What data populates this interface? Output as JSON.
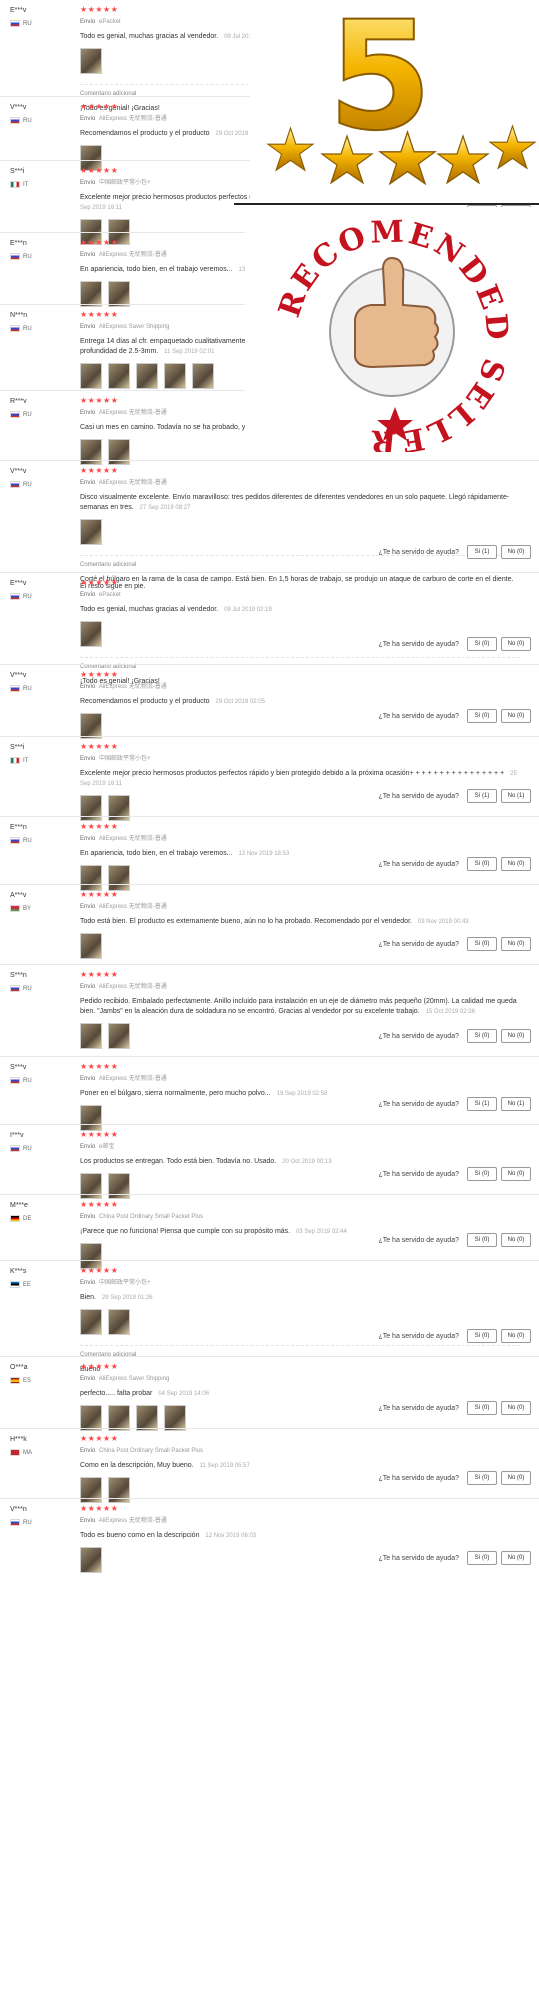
{
  "helpful_question": "¿Te ha servido de ayuda?",
  "shipping_label": "Envío",
  "additional_title": "Comentario adicional",
  "badge": {
    "number": "5",
    "stamp_text": "RECOMENDED SELLER"
  },
  "colors": {
    "star": "#ff4747",
    "gold": "#f4b400",
    "stamp_red": "#c4121e"
  },
  "reviews": [
    {
      "user": "E***v",
      "country": "RU",
      "stars": "★★★★★",
      "shipping": "ePacket",
      "text": "Todo es genial, muchas gracias al vendedor.",
      "date": "09 Jul 2019 02:19",
      "photos": 1,
      "additional": "¡Todo es genial! ¡Gracias!",
      "yes": "Sí (0)",
      "no": "No (0)"
    },
    {
      "user": "V***v",
      "country": "RU",
      "stars": "★★★★★",
      "shipping": "AliExpress 无忧物流-普通",
      "text": "Recomendamos el producto y el producto",
      "date": "29 Oct 2019 02:05",
      "photos": 1,
      "additional": "",
      "yes": "Sí (0)",
      "no": "No (0)"
    },
    {
      "user": "S***i",
      "country": "IT",
      "stars": "★★★★★",
      "shipping": "中国邮政平常小包+",
      "text": "Excelente mejor precio hermosos productos perfectos rápido y bien protegido debido a la próxima ocasión+ + + + + + + + + + + + + + + +",
      "date": "25 Sep 2019 16:11",
      "photos": 2,
      "additional": "",
      "yes": "Sí (1)",
      "no": "No (1)"
    },
    {
      "user": "E***n",
      "country": "RU",
      "stars": "★★★★★",
      "shipping": "AliExpress 无忧物流-普通",
      "text": "En apariencia, todo bien, en el trabajo veremos...",
      "date": "13 Nov 2019 18:53",
      "photos": 2,
      "additional": "",
      "yes": "Sí (0)",
      "no": "No (0)"
    },
    {
      "user": "N***n",
      "country": "RU",
      "stars": "★★★★★",
      "shipping": "AliExpress Saver Shipping",
      "text": "Entrega 14 días al cfr. empaquetado cualitativamente. El producto corresponde a la descripción. La adaptadora para 20mm., en la profundidad de 2.5-3mm.",
      "date": "11 Sep 2019 02:01",
      "photos": 5,
      "additional": "",
      "yes": "Sí (4)",
      "no": "No (3)"
    },
    {
      "user": "R***v",
      "country": "RU",
      "stars": "★★★★★",
      "shipping": "AliExpress 无忧物流-普通",
      "text": "Casi un mes en camino. Todavía no se ha probado, ya que estoy en el reloj",
      "date": "06 Nov 2019 23:08",
      "photos": 2,
      "additional": "",
      "yes": "Sí (0)",
      "no": "No (0)"
    },
    {
      "user": "V***v",
      "country": "RU",
      "stars": "★★★★★",
      "shipping": "AliExpress 无忧物流-普通",
      "text": "Disco visualmente excelente. Envío maravilloso: tres pedidos diferentes de diferentes vendedores en un solo paquete. Llegó rápidamente-semanas en tres.",
      "date": "27 Sep 2019 08:27",
      "photos": 1,
      "additional": "Corté el búlgaro en la rama de la casa de campo. Está bien. En 1,5 horas de trabajo, se produjo un ataque de carburo de corte en el diente. El resto sigue en pie.",
      "yes": "Sí (1)",
      "no": "No (0)"
    },
    {
      "user": "E***v",
      "country": "RU",
      "stars": "★★★★★",
      "shipping": "ePacket",
      "text": "Todo es genial, muchas gracias al vendedor.",
      "date": "09 Jul 2019 02:19",
      "photos": 1,
      "additional": "¡Todo es genial! ¡Gracias!",
      "yes": "Sí (0)",
      "no": "No (0)"
    },
    {
      "user": "V***v",
      "country": "RU",
      "stars": "★★★★★",
      "shipping": "AliExpress 无忧物流-普通",
      "text": "Recomendamos el producto y el producto",
      "date": "29 Oct 2019 02:05",
      "photos": 1,
      "additional": "",
      "yes": "Sí (0)",
      "no": "No (0)"
    },
    {
      "user": "S***i",
      "country": "IT",
      "stars": "★★★★★",
      "shipping": "中国邮政平常小包+",
      "text": "Excelente mejor precio hermosos productos perfectos rápido y bien protegido debido a la próxima ocasión+ + + + + + + + + + + + + + + +",
      "date": "25 Sep 2019 16:11",
      "photos": 2,
      "additional": "",
      "yes": "Sí (1)",
      "no": "No (1)"
    },
    {
      "user": "E***n",
      "country": "RU",
      "stars": "★★★★★",
      "shipping": "AliExpress 无忧物流-普通",
      "text": "En apariencia, todo bien, en el trabajo veremos...",
      "date": "13 Nov 2019 18:53",
      "photos": 2,
      "additional": "",
      "yes": "Sí (0)",
      "no": "No (0)"
    },
    {
      "user": "A***v",
      "country": "BY",
      "stars": "★★★★★",
      "shipping": "AliExpress 无忧物流-普通",
      "text": "Todo está bien. El producto es externamente bueno, aún no lo ha probado. Recomendado por el vendedor.",
      "date": "03 Nov 2019 00:43",
      "photos": 1,
      "additional": "",
      "yes": "Sí (0)",
      "no": "No (0)"
    },
    {
      "user": "S***n",
      "country": "RU",
      "stars": "★★★★★",
      "shipping": "AliExpress 无忧物流-普通",
      "text": "Pedido recibido. Embalado perfectamente. Anillo incluido para instalación en un eje de diámetro más pequeño (20mm). La calidad me queda bien. \"Jambs\" en la aleación dura de soldadura no se encontró. Gracias al vendedor por su excelente trabajo.",
      "date": "15 Oct 2019 02:36",
      "photos": 2,
      "additional": "",
      "yes": "Sí (0)",
      "no": "No (0)"
    },
    {
      "user": "S***v",
      "country": "RU",
      "stars": "★★★★★",
      "shipping": "AliExpress 无忧物流-普通",
      "text": "Poner en el búlgaro, sierra normalmente, pero mucho polvo...",
      "date": "19 Sep 2019 02:58",
      "photos": 1,
      "additional": "",
      "yes": "Sí (1)",
      "no": "No (1)"
    },
    {
      "user": "I***v",
      "country": "RU",
      "stars": "★★★★★",
      "shipping": "e邮宝",
      "text": "Los productos se entregan. Todo está bien. Todavía no. Usado.",
      "date": "20 Oct 2019 00:13",
      "photos": 2,
      "additional": "",
      "yes": "Sí (0)",
      "no": "No (0)"
    },
    {
      "user": "M***e",
      "country": "DE",
      "stars": "★★★★★",
      "shipping": "China Post Ordinary Small Packet Plus",
      "text": "¡Parece que no funciona! Piensa que cumple con su propósito más.",
      "date": "03 Sep 2019 02:44",
      "photos": 1,
      "additional": "",
      "yes": "Sí (0)",
      "no": "No (0)"
    },
    {
      "user": "K***s",
      "country": "EE",
      "stars": "★★★★★",
      "shipping": "中国邮政平常小包+",
      "text": "Bien.",
      "date": "29 Sep 2019 01:26",
      "photos": 2,
      "additional": "Bueno",
      "yes": "Sí (0)",
      "no": "No (0)"
    },
    {
      "user": "O***a",
      "country": "ES",
      "stars": "★★★★★",
      "shipping": "AliExpress Saver Shipping",
      "text": "perfecto..... falta probar",
      "date": "04 Sep 2019 14:06",
      "photos": 4,
      "additional": "",
      "yes": "Sí (0)",
      "no": "No (0)"
    },
    {
      "user": "H***k",
      "country": "MA",
      "stars": "★★★★★",
      "shipping": "China Post Ordinary Small Packet Plus",
      "text": "Como en la descripción, Muy bueno.",
      "date": "11 Sep 2019 05:57",
      "photos": 2,
      "additional": "",
      "yes": "Sí (0)",
      "no": "No (0)"
    },
    {
      "user": "V***n",
      "country": "RU",
      "stars": "★★★★★",
      "shipping": "AliExpress 无忧物流-普通",
      "text": "Todo es bueno como en la descripción",
      "date": "12 Nov 2019 06:03",
      "photos": 1,
      "additional": "",
      "yes": "Sí (0)",
      "no": "No (0)"
    }
  ]
}
